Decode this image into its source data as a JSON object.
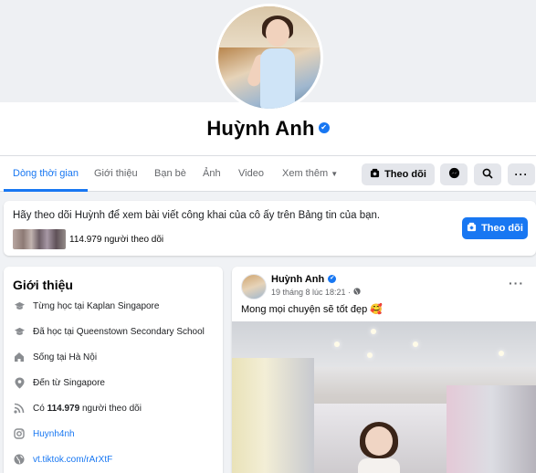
{
  "profile": {
    "name": "Huỳnh Anh",
    "verified_icon": "verified-badge-icon"
  },
  "tabs": [
    {
      "label": "Dòng thời gian",
      "active": true
    },
    {
      "label": "Giới thiệu"
    },
    {
      "label": "Bạn bè"
    },
    {
      "label": "Ảnh"
    },
    {
      "label": "Video"
    },
    {
      "label": "Xem thêm"
    }
  ],
  "actions": {
    "follow_label": "Theo dõi"
  },
  "follow_card": {
    "message": "Hãy theo dõi Huỳnh để xem bài viết công khai của cô ấy trên Bảng tin của bạn.",
    "followers": "114.979 người theo dõi",
    "button_label": "Theo dõi"
  },
  "intro": {
    "title": "Giới thiệu",
    "items": [
      {
        "icon": "graduation-cap-icon",
        "text": "Từng học tại Kaplan Singapore"
      },
      {
        "icon": "graduation-cap-icon",
        "text": "Đã học tại Queenstown Secondary School"
      },
      {
        "icon": "home-icon",
        "text": "Sống tại Hà Nội"
      },
      {
        "icon": "location-pin-icon",
        "text": "Đến từ Singapore"
      },
      {
        "icon": "rss-icon",
        "prefix": "Có ",
        "bold": "114.979",
        "suffix": " người theo dõi"
      },
      {
        "icon": "instagram-icon",
        "text": "Huynh4nh"
      },
      {
        "icon": "globe-icon",
        "text": "vt.tiktok.com/rArXtF"
      }
    ]
  },
  "post": {
    "author": "Huỳnh Anh",
    "time": "19 tháng 8 lúc 18:21 ·",
    "text": "Mong mọi chuyện sẽ tốt đẹp 🥰",
    "more": "···"
  },
  "colors": {
    "accent": "#1877f2",
    "page_bg": "#f0f2f5",
    "button_grey": "#e4e6eb"
  }
}
